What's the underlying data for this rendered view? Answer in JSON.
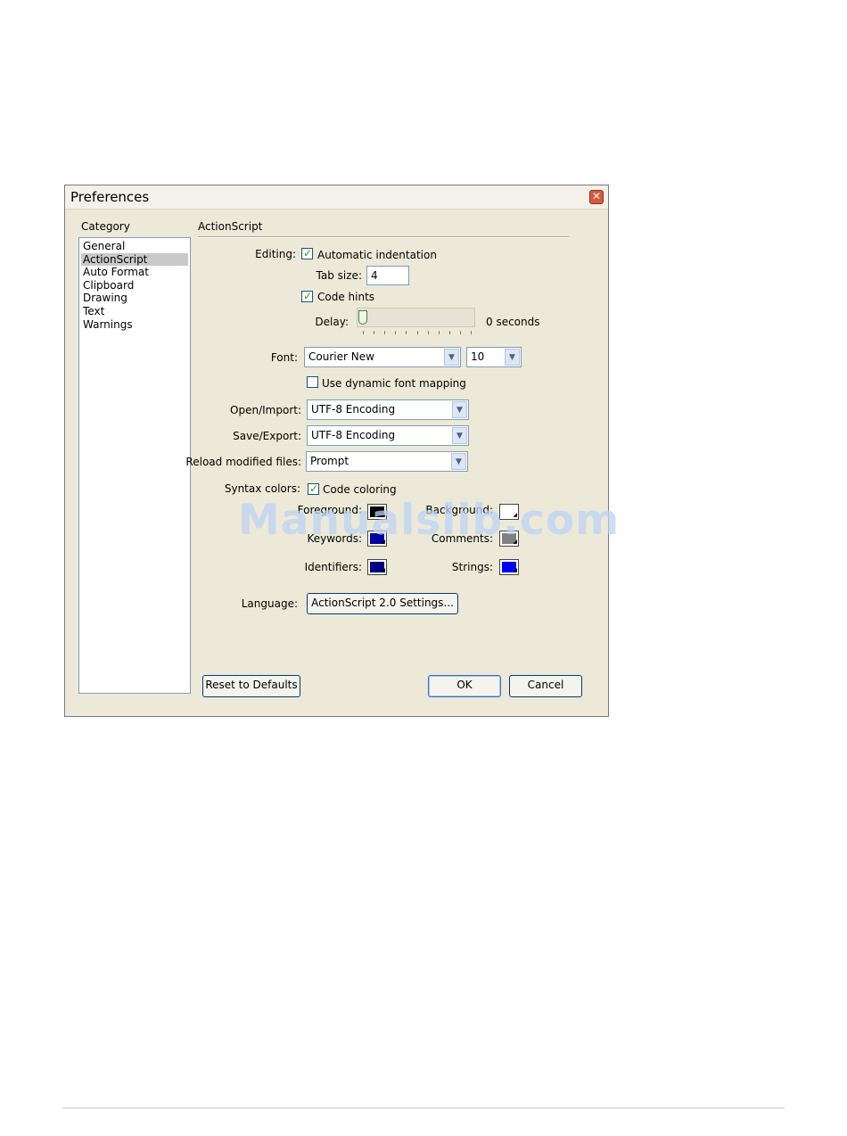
{
  "dialog": {
    "title": "Preferences",
    "close_glyph": "✕",
    "category_heading": "Category",
    "categories": [
      {
        "label": "General",
        "selected": false
      },
      {
        "label": "ActionScript",
        "selected": true
      },
      {
        "label": "Auto Format",
        "selected": false
      },
      {
        "label": "Clipboard",
        "selected": false
      },
      {
        "label": "Drawing",
        "selected": false
      },
      {
        "label": "Text",
        "selected": false
      },
      {
        "label": "Warnings",
        "selected": false
      }
    ],
    "section_title": "ActionScript"
  },
  "editing": {
    "label": "Editing:",
    "auto_indent_label": "Automatic indentation",
    "auto_indent_checked": true,
    "tab_size_label": "Tab size:",
    "tab_size_value": "4",
    "code_hints_label": "Code hints",
    "code_hints_checked": true,
    "delay_label": "Delay:",
    "delay_value_text": "0 seconds",
    "delay_fraction": 0
  },
  "font": {
    "label": "Font:",
    "family_value": "Courier New",
    "size_value": "10",
    "dynamic_mapping_label": "Use dynamic font mapping",
    "dynamic_mapping_checked": false
  },
  "encoding": {
    "open_label": "Open/Import:",
    "open_value": "UTF-8 Encoding",
    "save_label": "Save/Export:",
    "save_value": "UTF-8 Encoding",
    "reload_label": "Reload modified files:",
    "reload_value": "Prompt"
  },
  "syntax": {
    "label": "Syntax colors:",
    "coloring_label": "Code coloring",
    "coloring_checked": true,
    "colors": {
      "foreground": {
        "label": "Foreground:",
        "color": "#000000"
      },
      "background": {
        "label": "Background:",
        "color": "#ffffff"
      },
      "keywords": {
        "label": "Keywords:",
        "color": "#0000a0"
      },
      "comments": {
        "label": "Comments:",
        "color": "#808080"
      },
      "identifiers": {
        "label": "Identifiers:",
        "color": "#000080"
      },
      "strings": {
        "label": "Strings:",
        "color": "#0000ff"
      }
    }
  },
  "language": {
    "label": "Language:",
    "settings_button": "ActionScript 2.0 Settings..."
  },
  "buttons": {
    "reset": "Reset to Defaults",
    "ok": "OK",
    "cancel": "Cancel"
  },
  "watermark": "Manualslib.com"
}
